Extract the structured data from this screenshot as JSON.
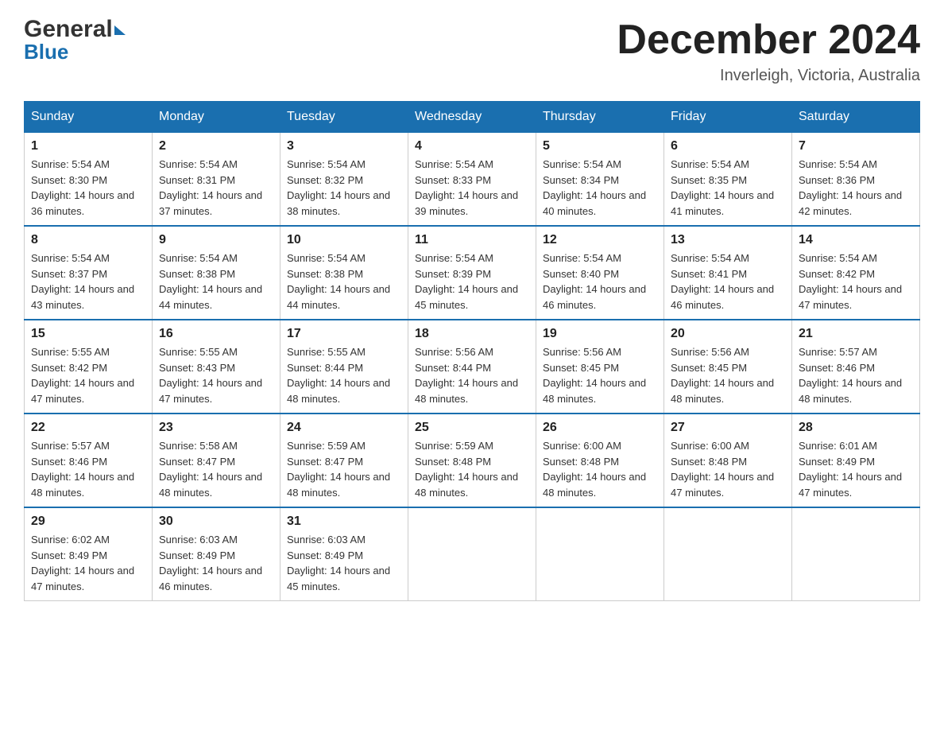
{
  "header": {
    "logo_general": "General",
    "logo_blue": "Blue",
    "title": "December 2024",
    "subtitle": "Inverleigh, Victoria, Australia"
  },
  "calendar": {
    "days_of_week": [
      "Sunday",
      "Monday",
      "Tuesday",
      "Wednesday",
      "Thursday",
      "Friday",
      "Saturday"
    ],
    "weeks": [
      [
        {
          "number": "1",
          "sunrise": "5:54 AM",
          "sunset": "8:30 PM",
          "daylight": "14 hours and 36 minutes."
        },
        {
          "number": "2",
          "sunrise": "5:54 AM",
          "sunset": "8:31 PM",
          "daylight": "14 hours and 37 minutes."
        },
        {
          "number": "3",
          "sunrise": "5:54 AM",
          "sunset": "8:32 PM",
          "daylight": "14 hours and 38 minutes."
        },
        {
          "number": "4",
          "sunrise": "5:54 AM",
          "sunset": "8:33 PM",
          "daylight": "14 hours and 39 minutes."
        },
        {
          "number": "5",
          "sunrise": "5:54 AM",
          "sunset": "8:34 PM",
          "daylight": "14 hours and 40 minutes."
        },
        {
          "number": "6",
          "sunrise": "5:54 AM",
          "sunset": "8:35 PM",
          "daylight": "14 hours and 41 minutes."
        },
        {
          "number": "7",
          "sunrise": "5:54 AM",
          "sunset": "8:36 PM",
          "daylight": "14 hours and 42 minutes."
        }
      ],
      [
        {
          "number": "8",
          "sunrise": "5:54 AM",
          "sunset": "8:37 PM",
          "daylight": "14 hours and 43 minutes."
        },
        {
          "number": "9",
          "sunrise": "5:54 AM",
          "sunset": "8:38 PM",
          "daylight": "14 hours and 44 minutes."
        },
        {
          "number": "10",
          "sunrise": "5:54 AM",
          "sunset": "8:38 PM",
          "daylight": "14 hours and 44 minutes."
        },
        {
          "number": "11",
          "sunrise": "5:54 AM",
          "sunset": "8:39 PM",
          "daylight": "14 hours and 45 minutes."
        },
        {
          "number": "12",
          "sunrise": "5:54 AM",
          "sunset": "8:40 PM",
          "daylight": "14 hours and 46 minutes."
        },
        {
          "number": "13",
          "sunrise": "5:54 AM",
          "sunset": "8:41 PM",
          "daylight": "14 hours and 46 minutes."
        },
        {
          "number": "14",
          "sunrise": "5:54 AM",
          "sunset": "8:42 PM",
          "daylight": "14 hours and 47 minutes."
        }
      ],
      [
        {
          "number": "15",
          "sunrise": "5:55 AM",
          "sunset": "8:42 PM",
          "daylight": "14 hours and 47 minutes."
        },
        {
          "number": "16",
          "sunrise": "5:55 AM",
          "sunset": "8:43 PM",
          "daylight": "14 hours and 47 minutes."
        },
        {
          "number": "17",
          "sunrise": "5:55 AM",
          "sunset": "8:44 PM",
          "daylight": "14 hours and 48 minutes."
        },
        {
          "number": "18",
          "sunrise": "5:56 AM",
          "sunset": "8:44 PM",
          "daylight": "14 hours and 48 minutes."
        },
        {
          "number": "19",
          "sunrise": "5:56 AM",
          "sunset": "8:45 PM",
          "daylight": "14 hours and 48 minutes."
        },
        {
          "number": "20",
          "sunrise": "5:56 AM",
          "sunset": "8:45 PM",
          "daylight": "14 hours and 48 minutes."
        },
        {
          "number": "21",
          "sunrise": "5:57 AM",
          "sunset": "8:46 PM",
          "daylight": "14 hours and 48 minutes."
        }
      ],
      [
        {
          "number": "22",
          "sunrise": "5:57 AM",
          "sunset": "8:46 PM",
          "daylight": "14 hours and 48 minutes."
        },
        {
          "number": "23",
          "sunrise": "5:58 AM",
          "sunset": "8:47 PM",
          "daylight": "14 hours and 48 minutes."
        },
        {
          "number": "24",
          "sunrise": "5:59 AM",
          "sunset": "8:47 PM",
          "daylight": "14 hours and 48 minutes."
        },
        {
          "number": "25",
          "sunrise": "5:59 AM",
          "sunset": "8:48 PM",
          "daylight": "14 hours and 48 minutes."
        },
        {
          "number": "26",
          "sunrise": "6:00 AM",
          "sunset": "8:48 PM",
          "daylight": "14 hours and 48 minutes."
        },
        {
          "number": "27",
          "sunrise": "6:00 AM",
          "sunset": "8:48 PM",
          "daylight": "14 hours and 47 minutes."
        },
        {
          "number": "28",
          "sunrise": "6:01 AM",
          "sunset": "8:49 PM",
          "daylight": "14 hours and 47 minutes."
        }
      ],
      [
        {
          "number": "29",
          "sunrise": "6:02 AM",
          "sunset": "8:49 PM",
          "daylight": "14 hours and 47 minutes."
        },
        {
          "number": "30",
          "sunrise": "6:03 AM",
          "sunset": "8:49 PM",
          "daylight": "14 hours and 46 minutes."
        },
        {
          "number": "31",
          "sunrise": "6:03 AM",
          "sunset": "8:49 PM",
          "daylight": "14 hours and 45 minutes."
        },
        null,
        null,
        null,
        null
      ]
    ],
    "labels": {
      "sunrise": "Sunrise:",
      "sunset": "Sunset:",
      "daylight": "Daylight:"
    }
  }
}
